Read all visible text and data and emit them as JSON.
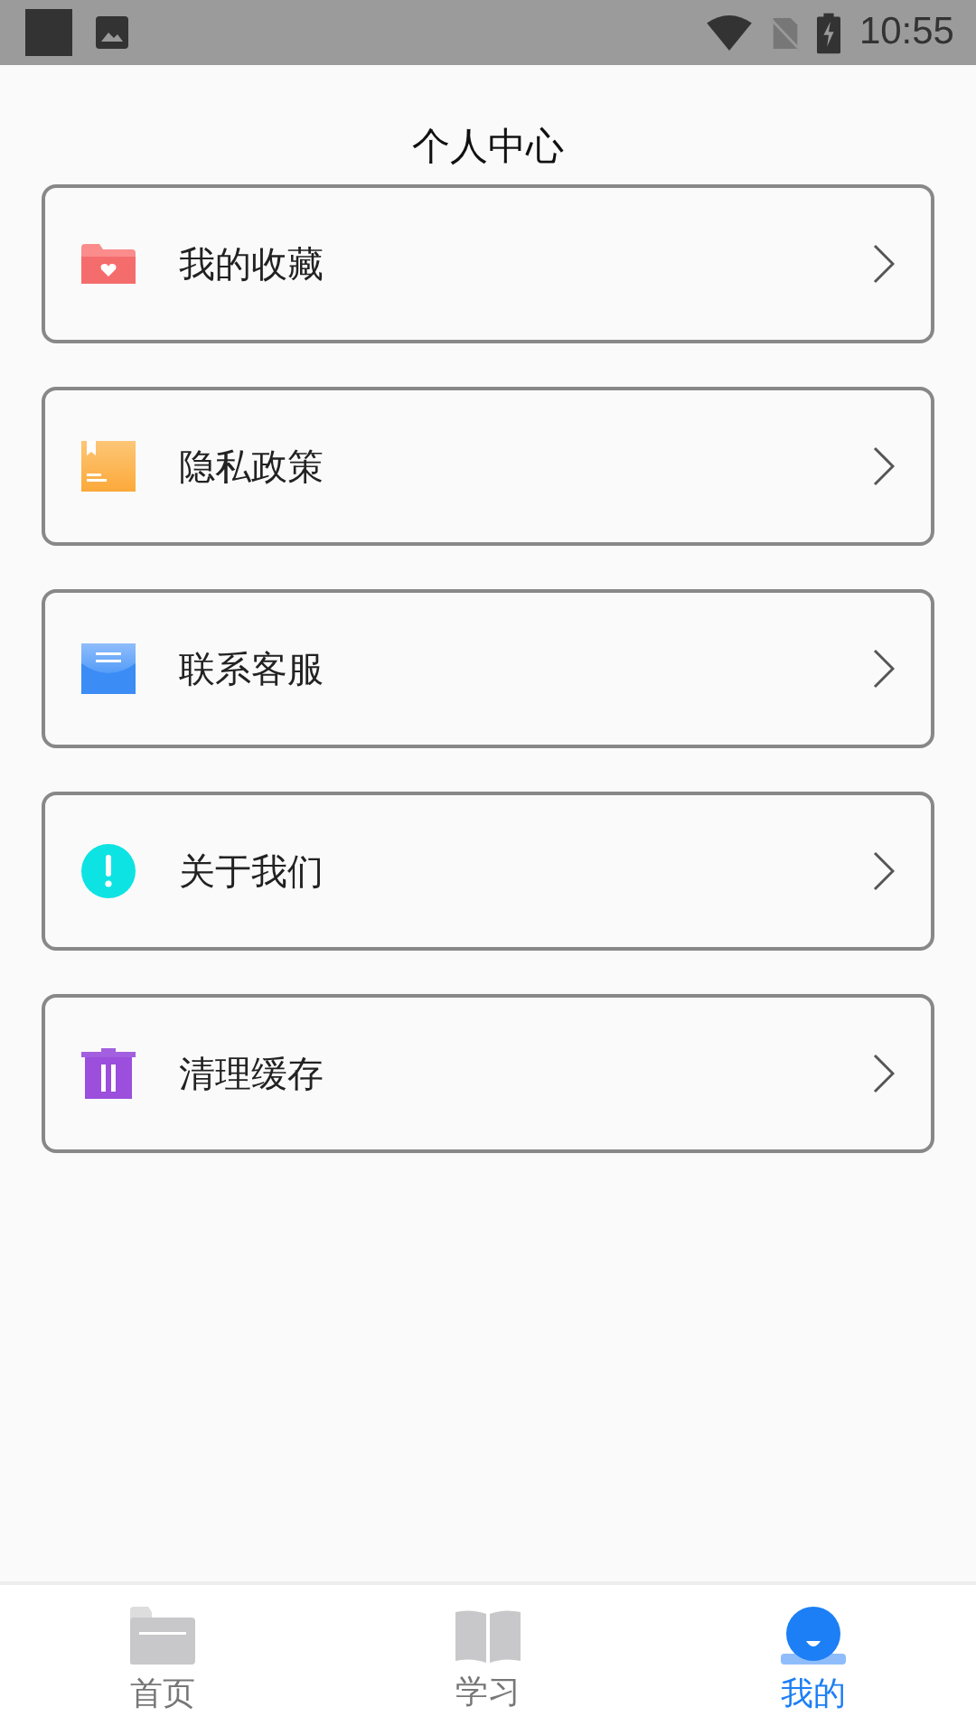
{
  "status_bar": {
    "time": "10:55"
  },
  "title": "个人中心",
  "menu": [
    {
      "kind": "favorites",
      "label": "我的收藏"
    },
    {
      "kind": "privacy",
      "label": "隐私政策"
    },
    {
      "kind": "service",
      "label": "联系客服"
    },
    {
      "kind": "about",
      "label": "关于我们"
    },
    {
      "kind": "cache",
      "label": "清理缓存"
    }
  ],
  "tabs": [
    {
      "kind": "home",
      "label": "首页",
      "selected": false
    },
    {
      "kind": "study",
      "label": "学习",
      "selected": false
    },
    {
      "kind": "me",
      "label": "我的",
      "selected": true
    }
  ]
}
